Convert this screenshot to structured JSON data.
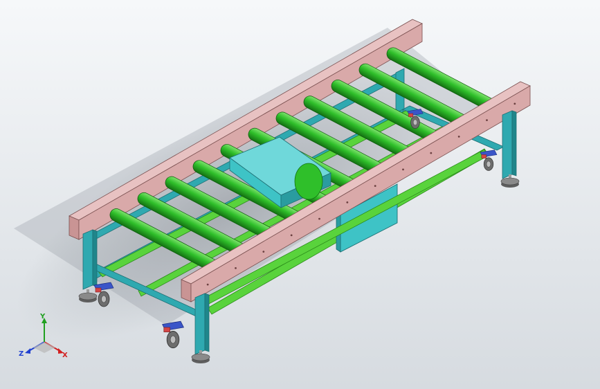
{
  "viewport": {
    "background_top": "#f6f8fa",
    "background_bottom": "#d6dbe0"
  },
  "model": {
    "roller_count": 11,
    "colors": {
      "side_rail": "#d9a9a9",
      "roller": "#2fbf2a",
      "frame": "#2fa9b0",
      "cross_bar": "#59d33c",
      "motor_housing": "#3ec3c6",
      "caster_wheel": "#6d6d6d",
      "caster_bracket": "#3a55c8",
      "caster_clamp": "#d34646",
      "foot_pad": "#8a8a8a"
    }
  },
  "triad": {
    "x_label": "X",
    "y_label": "Y",
    "z_label": "Z",
    "x_color": "#d22020",
    "y_color": "#20a020",
    "z_color": "#2040d0"
  }
}
